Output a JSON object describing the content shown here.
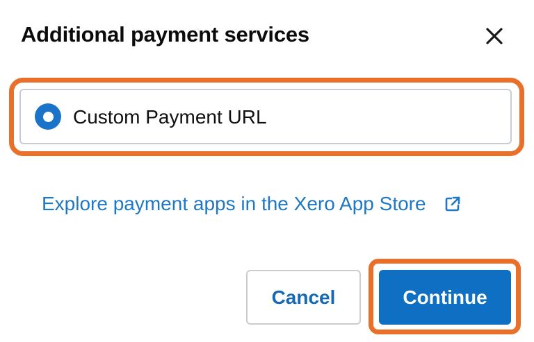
{
  "dialog": {
    "title": "Additional payment services",
    "close_icon": "close-icon"
  },
  "option": {
    "label": "Custom Payment URL",
    "selected": true,
    "radio_color": "#1a73c8"
  },
  "app_store_link": {
    "label": "Explore payment apps in the Xero App Store",
    "icon": "external-link-icon",
    "color": "#1f78c4"
  },
  "buttons": {
    "cancel_label": "Cancel",
    "continue_label": "Continue",
    "primary_color": "#0f6fc2"
  },
  "highlight_color": "#e8702a"
}
